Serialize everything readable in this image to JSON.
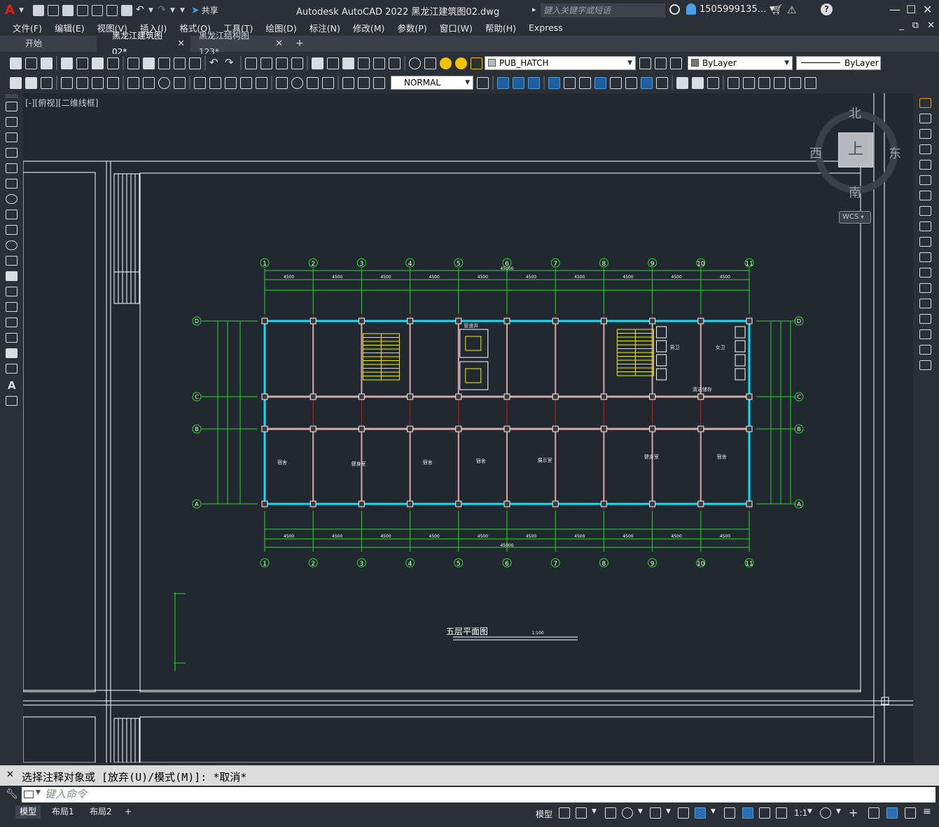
{
  "app": {
    "logo": "A",
    "title": "Autodesk AutoCAD 2022    黑龙江建筑图02.dwg",
    "share_label": "共享",
    "search_placeholder": "键入关键字或短语",
    "user_name": "1505999135...",
    "window_controls": [
      "minimize-icon",
      "maximize-icon",
      "close-icon"
    ]
  },
  "menu": {
    "items": [
      "文件(F)",
      "编辑(E)",
      "视图(V)",
      "插入(I)",
      "格式(O)",
      "工具(T)",
      "绘图(D)",
      "标注(N)",
      "修改(M)",
      "参数(P)",
      "窗口(W)",
      "帮助(H)",
      "Express"
    ]
  },
  "file_tabs": [
    {
      "label": "开始",
      "active": false,
      "closable": false
    },
    {
      "label": "黑龙江建筑图02*",
      "active": true,
      "closable": true
    },
    {
      "label": "黑龙江结构图123*",
      "active": false,
      "closable": true
    }
  ],
  "toolbar1": {
    "layer_combo": "PUB_HATCH",
    "color_combo": "ByLayer",
    "linetype_combo": "ByLayer"
  },
  "toolbar2": {
    "dimstyle_combo": "NORMAL"
  },
  "viewport": {
    "label": "[-][俯视][二维线框]",
    "drawing_title": "五层平面图",
    "drawing_scale": "1:100",
    "colors": {
      "background": "#212830",
      "border": "#ffffff",
      "dimension": "#22e022",
      "wall": "#00e5ff",
      "axis": "#e01818",
      "stair": "#f2f200"
    },
    "axis_top": [
      "1",
      "2",
      "3",
      "4",
      "5",
      "6",
      "7",
      "8",
      "9",
      "10",
      "11"
    ],
    "axis_side": [
      "D",
      "C",
      "B",
      "A"
    ],
    "dims_top": [
      "4500",
      "4500",
      "4500",
      "4500",
      "4500",
      "4500",
      "4500",
      "4500",
      "4500",
      "4500"
    ],
    "dims_total": "45000",
    "rooms": [
      "宿舍",
      "健身室",
      "宿舍",
      "宿舍",
      "展示室",
      "健身室",
      "宿舍",
      "管道井",
      "男卫",
      "女卫",
      "清洁储存"
    ]
  },
  "viewcube": {
    "north": "北",
    "south": "南",
    "east": "东",
    "west": "西",
    "face": "上",
    "wcs": "WCS"
  },
  "command": {
    "history": "选择注释对象或 [放弃(U)/模式(M)]: *取消*",
    "placeholder": "键入命令"
  },
  "status": {
    "layout_tabs": [
      "模型",
      "布局1",
      "布局2"
    ],
    "model_label": "模型",
    "scale": "1:1"
  }
}
